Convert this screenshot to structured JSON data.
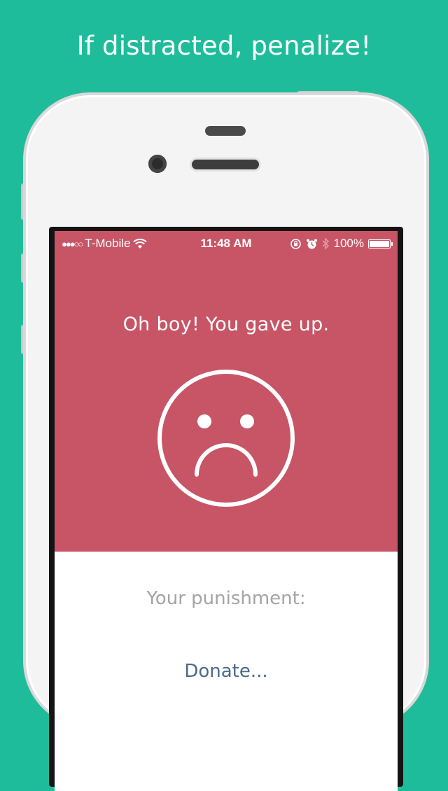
{
  "headline": "If distracted, penalize!",
  "status_bar": {
    "signal": "●●●○○",
    "carrier": "T-Mobile",
    "time": "11:48 AM",
    "battery_percent": "100%",
    "battery_level": 1.0,
    "icons": [
      "wifi-icon",
      "orientation-lock-icon",
      "alarm-icon",
      "bluetooth-icon",
      "battery-icon"
    ]
  },
  "result": {
    "message": "Oh boy! You gave up.",
    "face_icon": "sad-face-icon"
  },
  "punishment": {
    "label": "Your punishment:",
    "text": "Donate..."
  },
  "colors": {
    "background": "#1fbc9c",
    "hero": "#c75566",
    "lower": "#ffffff",
    "label": "#a4a4a4",
    "punishment_text": "#4a6a88"
  }
}
